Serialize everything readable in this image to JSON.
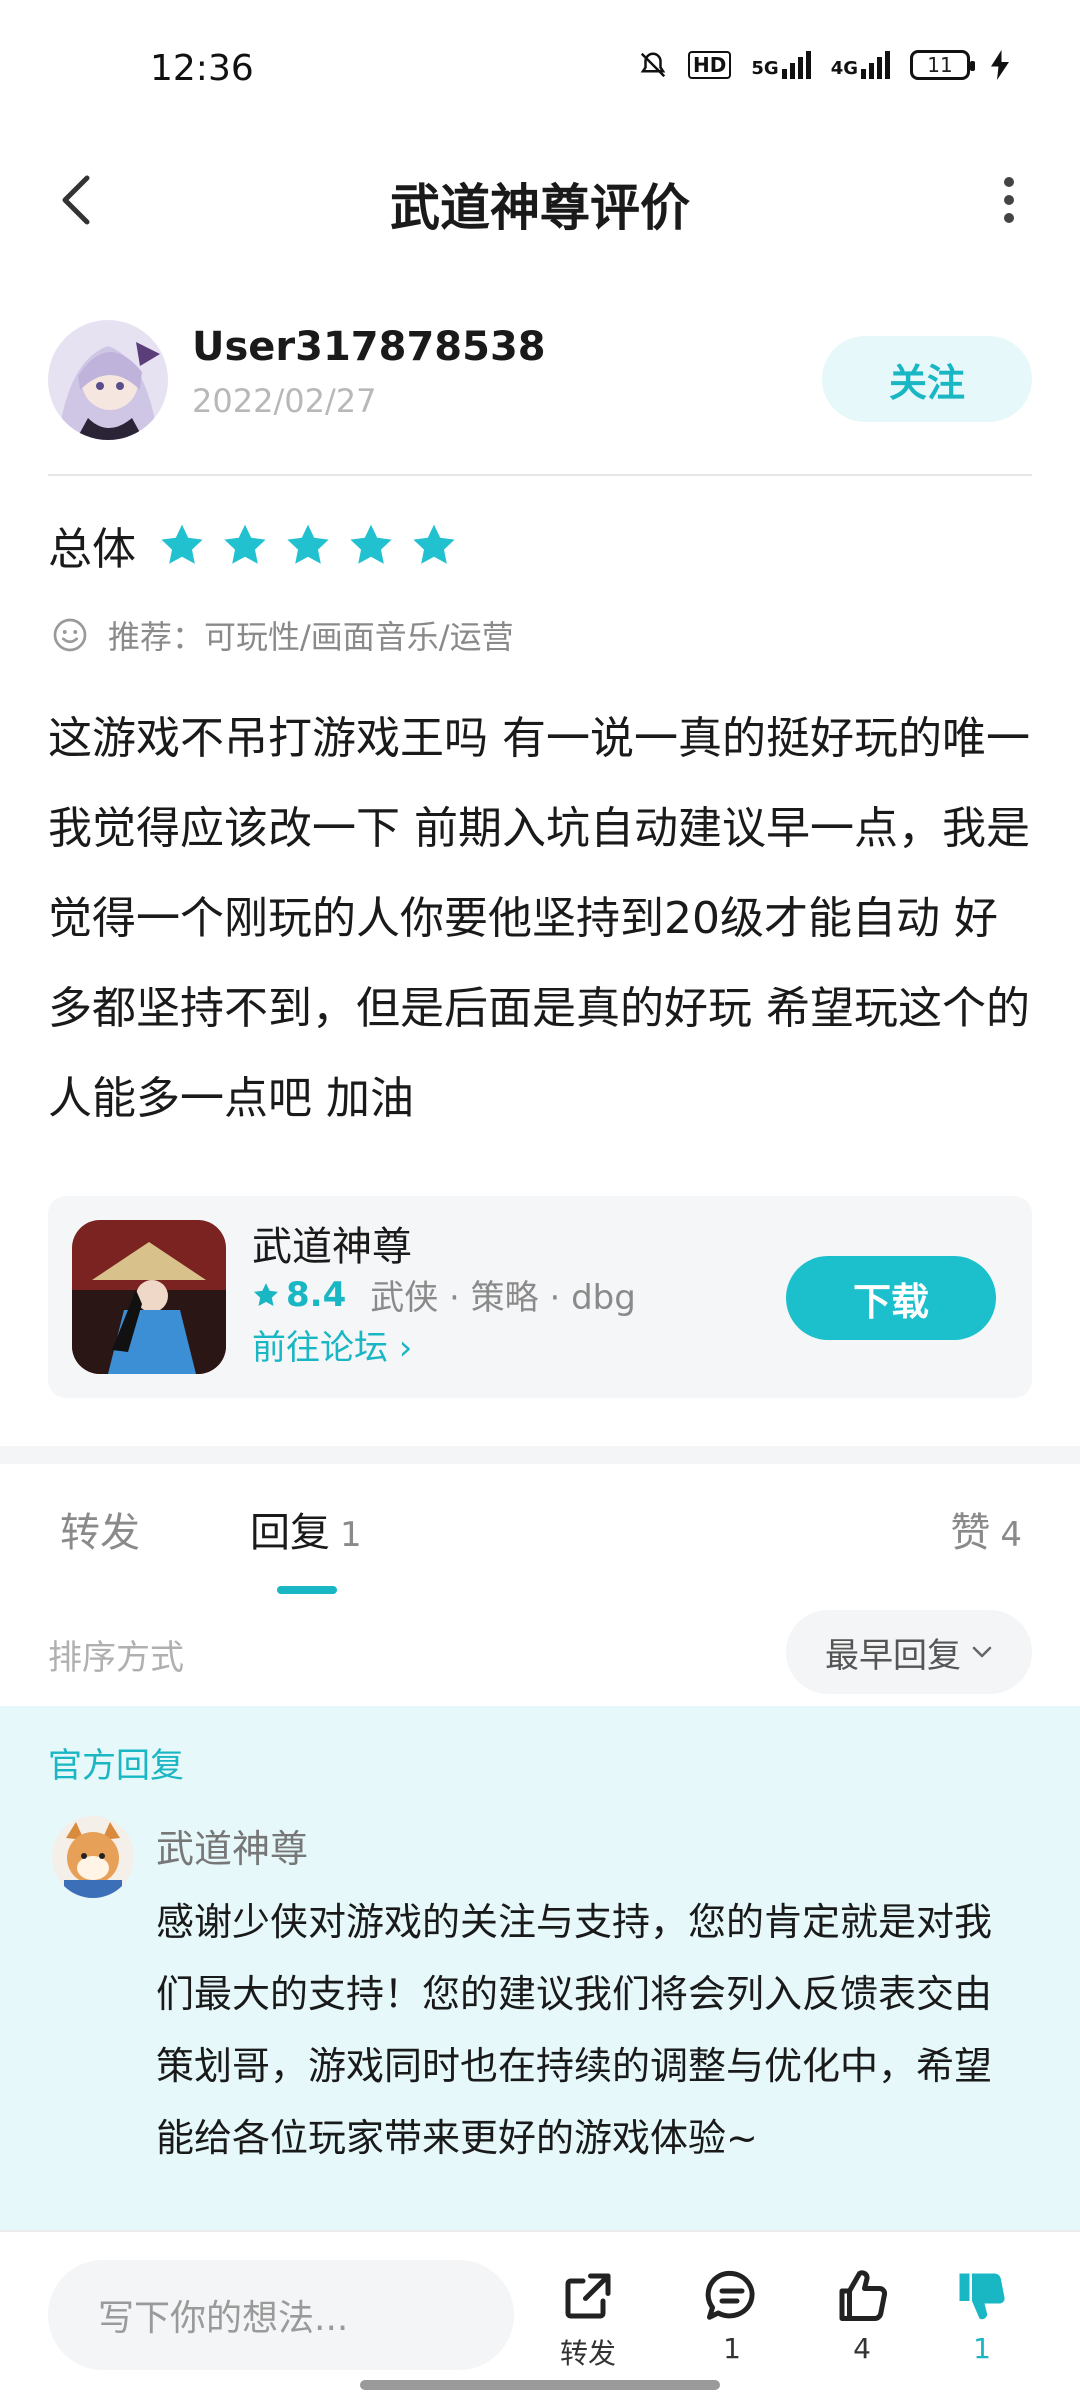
{
  "status_bar": {
    "time": "12:36",
    "hd_label": "HD",
    "signal_5g": "5G",
    "signal_4g": "4G",
    "battery": "11"
  },
  "header": {
    "title": "武道神尊评价"
  },
  "author": {
    "username": "User317878538",
    "date": "2022/02/27",
    "follow_label": "关注"
  },
  "rating": {
    "label": "总体",
    "stars": 5,
    "star_color": "#22c1d0"
  },
  "recommend": {
    "text": "推荐：可玩性/画面音乐/运营"
  },
  "review": {
    "text": "这游戏不吊打游戏王吗 有一说一真的挺好玩的唯一我觉得应该改一下 前期入坑自动建议早一点，我是觉得一个刚玩的人你要他坚持到20级才能自动 好多都坚持不到，但是后面是真的好玩 希望玩这个的人能多一点吧 加油"
  },
  "app": {
    "name": "武道神尊",
    "score": "8.4",
    "tags": "武侠 · 策略 · dbg",
    "forum_link": "前往论坛 ›",
    "download_label": "下载"
  },
  "tabs": {
    "forward": "转发",
    "reply": "回复",
    "reply_count": "1",
    "like": "赞",
    "like_count": "4"
  },
  "sort": {
    "label": "排序方式",
    "selected": "最早回复"
  },
  "official_reply": {
    "label": "官方回复",
    "name": "武道神尊",
    "text": "感谢少侠对游戏的关注与支持，您的肯定就是对我们最大的支持！您的建议我们将会列入反馈表交由策划哥，游戏同时也在持续的调整与优化中，希望能给各位玩家带来更好的游戏体验~"
  },
  "bottom_bar": {
    "input_placeholder": "写下你的想法...",
    "share_label": "转发",
    "comment_count": "1",
    "like_count": "4",
    "dislike_count": "1"
  },
  "colors": {
    "accent": "#19b6c4",
    "accent_light": "#e6f8f9",
    "download_bg": "#1cbfcc"
  }
}
